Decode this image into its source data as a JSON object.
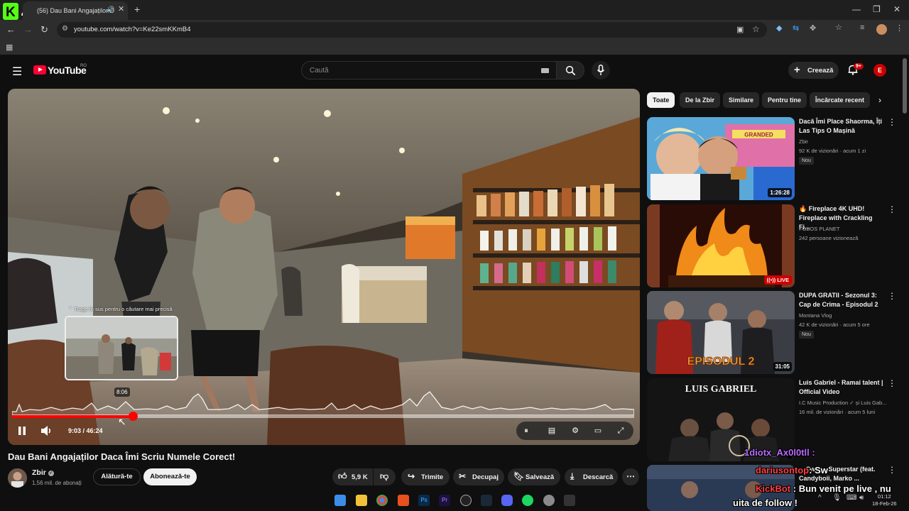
{
  "browser": {
    "tab_title": "(56) Dau Bani Angajaților D",
    "url": "youtube.com/watch?v=Ke22smKKmB4",
    "overlay_logo": "K4"
  },
  "youtube": {
    "logo_text": "YouTube",
    "region": "RO",
    "search_placeholder": "Caută",
    "create_label": "Creează",
    "notifications_badge": "9+",
    "avatar_letter": "E"
  },
  "player": {
    "hint": "⌃ Trage în sus pentru o căutare mai precisă",
    "preview_time": "8:06",
    "time": "9:03 / 46:24",
    "progress_fraction": 0.195
  },
  "video": {
    "title": "Dau Bani Angajaților Daca Îmi Scriu Numele Corect!",
    "channel": "Zbir",
    "subscribers": "1,56 mil. de abonați",
    "join_label": "Alătură-te",
    "subscribe_label": "Abonează-te",
    "likes": "5,9 K",
    "share_label": "Trimite",
    "clip_label": "Decupaj",
    "save_label": "Salvează",
    "download_label": "Descarcă"
  },
  "chips": [
    "Toate",
    "De la Zbir",
    "Similare",
    "Pentru tine",
    "Încărcate recent"
  ],
  "recommendations": [
    {
      "title": "Dacă Îmi Place Shaorma, Îți Las Tips O Mașină",
      "channel": "Zbir",
      "meta": "92 K de vizionări · acum 1 zi",
      "badge": "Nou",
      "duration": "1:26:28",
      "thumb_text": "GRANDED"
    },
    {
      "title": "🔥 Fireplace 4K UHD! Fireplace with Crackling Fi...",
      "channel": "FOBOS PLANET",
      "meta": "242 persoane vizionează",
      "live": "LIVE"
    },
    {
      "title": "DUPA GRATII - Sezonul 3: Cap de Crima - Episodul 2",
      "channel": "Montana Vlog",
      "meta": "42 K de vizionări · acum 5 ore",
      "badge": "Nou",
      "duration": "31:05",
      "thumb_text": "EPISODUL 2"
    },
    {
      "title": "Luis Gabriel - Ramai talent | Official Video",
      "channel": "I.C Music Production",
      "channel_extra": "și Luis Gab...",
      "meta": "16 mil. de vizionări · acum 5 luni",
      "duration": "",
      "thumb_text": "LUIS GABRIEL"
    },
    {
      "title": "... Swan - Superstar (feat. Candyboii, Marko ...",
      "channel": "",
      "meta": ""
    }
  ],
  "chat": {
    "line1": "1diotx_Ax0l0tll :",
    "line2_user": "dariusontop",
    "line2_text": ": Sw",
    "line3_user": "KickBot",
    "line3_text": ": Bun venit pe live , nu",
    "line4": "uita de follow !"
  },
  "clock": {
    "time": "01:12",
    "date": "18-Feb-26"
  }
}
